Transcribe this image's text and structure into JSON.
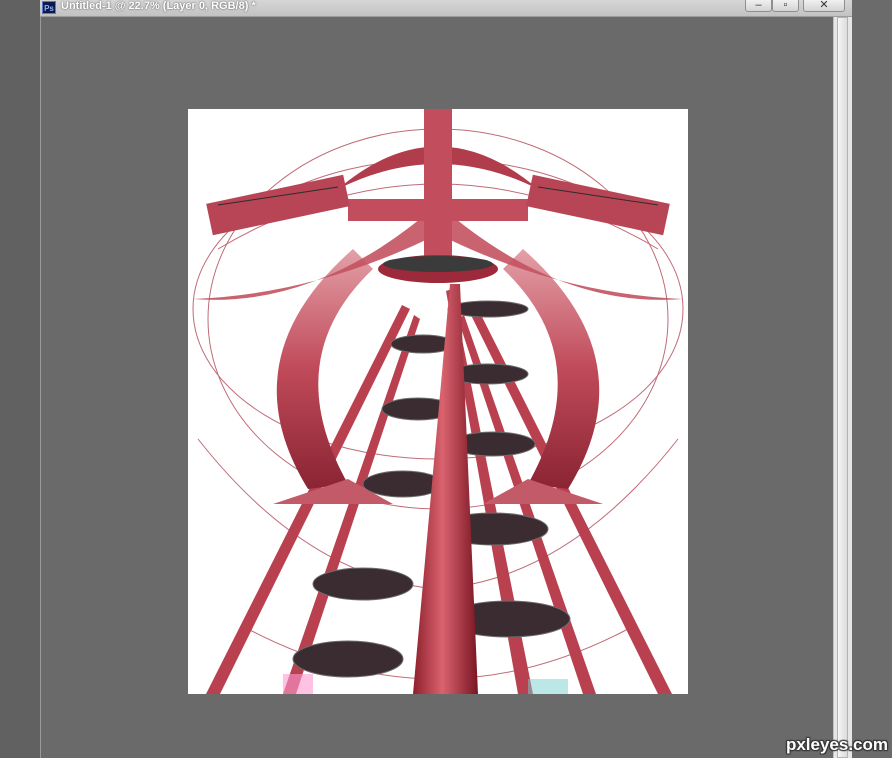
{
  "app": {
    "icon_label": "Ps",
    "window_title": "Untitled-1 @ 22.7% (Layer 0, RGB/8) *"
  },
  "window_controls": {
    "minimize": "–",
    "maximize": "▫",
    "close": "✕"
  },
  "watermark": "pxleyes.com",
  "colors": {
    "workspace": "#6b6b6b",
    "document_bg": "#ffffff",
    "accent_red": "#c8414f"
  }
}
